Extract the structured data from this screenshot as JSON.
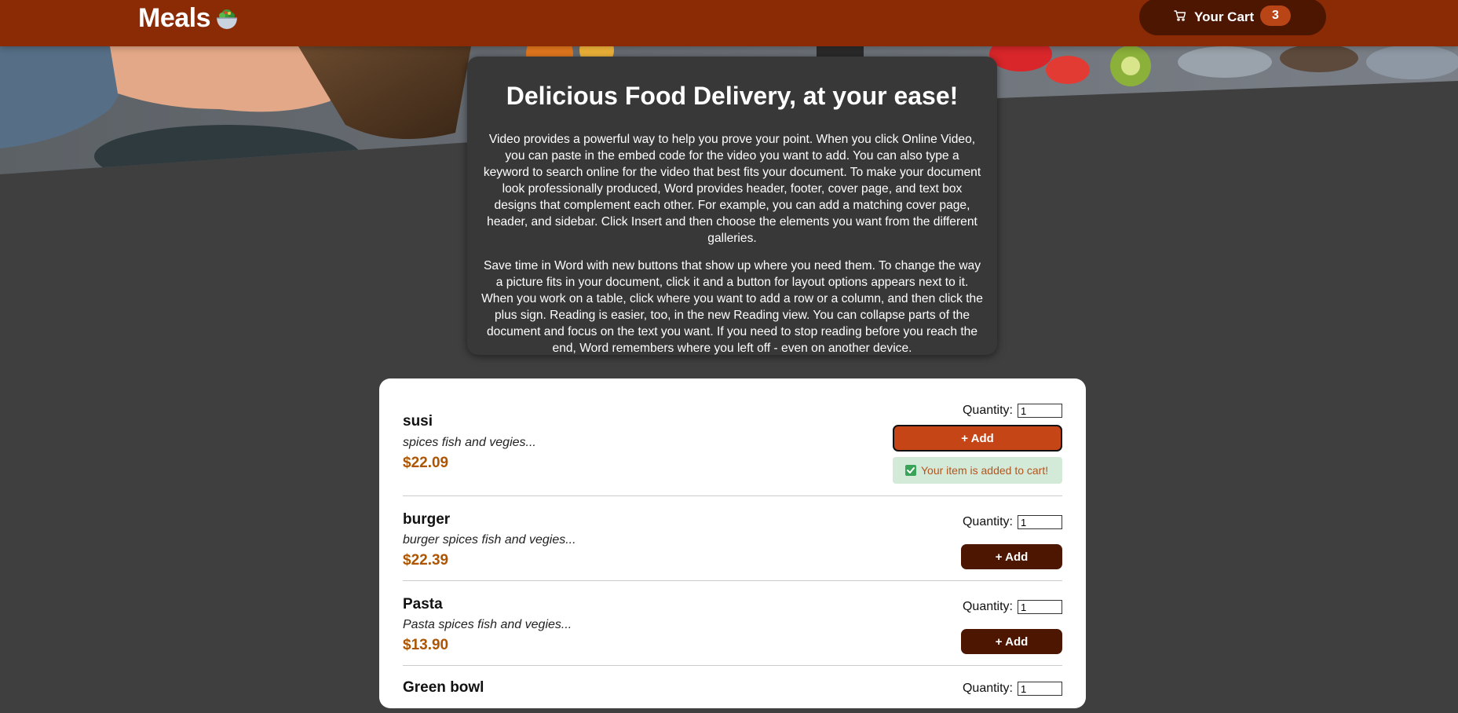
{
  "header": {
    "logo_text": "Meals",
    "logo_icon": "salad-bowl-icon",
    "cart": {
      "icon": "cart-icon",
      "label": "Your Cart",
      "count": "3"
    }
  },
  "summary": {
    "title": "Delicious Food Delivery, at your ease!",
    "paragraphs": [
      "Video provides a powerful way to help you prove your point. When you click Online Video, you can paste in the embed code for the video you want to add. You can also type a keyword to search online for the video that best fits your document. To make your document look professionally produced, Word provides header, footer, cover page, and text box designs that complement each other. For example, you can add a matching cover page, header, and sidebar. Click Insert and then choose the elements you want from the different galleries.",
      "Save time in Word with new buttons that show up where you need them. To change the way a picture fits in your document, click it and a button for layout options appears next to it. When you work on a table, click where you want to add a row or a column, and then click the plus sign. Reading is easier, too, in the new Reading view. You can collapse parts of the document and focus on the text you want. If you need to stop reading before you reach the end, Word remembers where you left off - even on another device."
    ]
  },
  "meals": [
    {
      "name": "susi",
      "description": "spices fish and vegies...",
      "price": "$22.09",
      "quantity_label": "Quantity:",
      "quantity_value": "1",
      "add_label": "+ Add",
      "toast": "Your item is added to cart!"
    },
    {
      "name": "burger",
      "description": "burger spices fish and vegies...",
      "price": "$22.39",
      "quantity_label": "Quantity:",
      "quantity_value": "1",
      "add_label": "+ Add"
    },
    {
      "name": "Pasta",
      "description": "Pasta spices fish and vegies...",
      "price": "$13.90",
      "quantity_label": "Quantity:",
      "quantity_value": "1",
      "add_label": "+ Add"
    },
    {
      "name": "Green bowl",
      "quantity_label": "Quantity:",
      "quantity_value": "1"
    }
  ],
  "colors": {
    "header_bg": "#8a2b06",
    "cart_bg": "#4d1601",
    "badge_bg": "#b94517",
    "page_bg": "#3f3f3f",
    "summary_bg": "#383838",
    "price": "#ad5502",
    "add_active": "#c54516",
    "add_default": "#4d1601",
    "toast_bg": "#d3ead8",
    "toast_text": "#b5541c"
  }
}
